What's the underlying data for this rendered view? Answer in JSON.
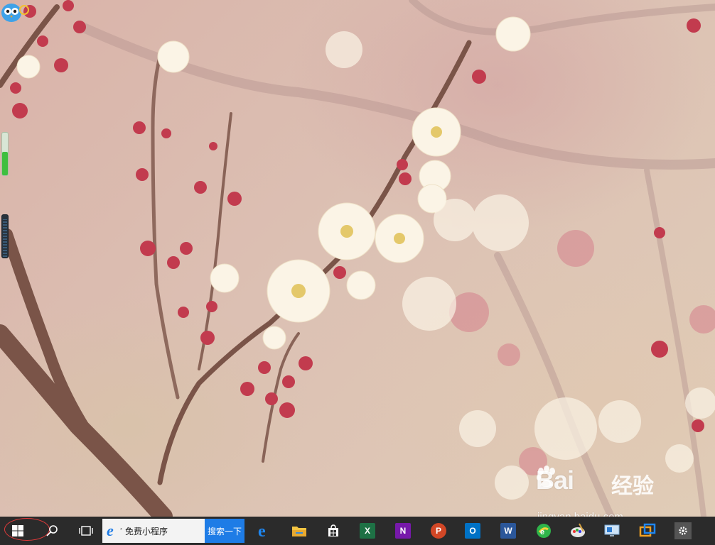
{
  "desktop": {
    "wallpaper": "plum blossom branch",
    "mascot_icon": "owl-mascot-icon"
  },
  "watermark": {
    "brand": "Bai",
    "suffix": "经验",
    "url": "jingyan.baidu.com"
  },
  "side_widgets": {
    "green_level": 0.55,
    "dark_level": 0.9
  },
  "taskbar": {
    "background": "#2b2b2b",
    "search": {
      "placeholder": "免费小程序",
      "button_label": "搜索一下",
      "button_color": "#1e7ce6"
    },
    "pinned_apps": [
      "edge-icon",
      "file-explorer-icon",
      "store-icon",
      "excel-icon",
      "onenote-icon",
      "powerpoint-icon",
      "outlook-icon",
      "word-icon",
      "360-browser-icon",
      "paint-icon",
      "remote-desktop-icon",
      "virtualbox-icon",
      "settings-icon"
    ],
    "highlight_color": "#e23a3a"
  }
}
